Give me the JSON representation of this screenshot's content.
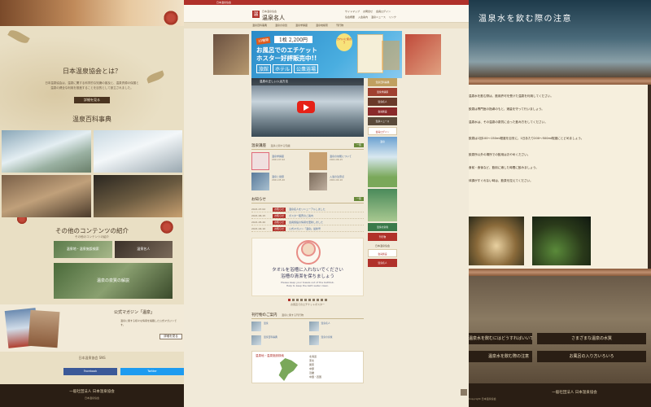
{
  "left": {
    "about_title": "日本温泉協会とは？",
    "about_text": "日本温泉協会は、温泉に関する科学的な知識の普及と、温泉資源の保護と温泉の健全な利用を推進することを目的として設立されました。",
    "about_button": "詳細を見る",
    "dictionary_title": "温泉百科事典",
    "other_title": "その他のコンテンツの紹介",
    "other_sub": "その他のコンテンツの紹介",
    "other_tiles": [
      "温泉地・温泉施設検索",
      "温泉名人",
      "温泉の泉質の解説"
    ],
    "magazine_title": "公式マガジン「温泉」",
    "magazine_text": "温泉に関する様々な情報を掲載した公式マガジンです。",
    "magazine_button": "詳細を見る",
    "sns_caption": "日本温泉協会 SNS",
    "sns_facebook": "Facebook",
    "sns_twitter": "Twitter",
    "footer_org": "一般社団法人 日本温泉協会",
    "footer_small": "日本温泉協会"
  },
  "center": {
    "topbar": "日本温泉協会",
    "logo_mark": "温",
    "logo_sub": "日本温泉協会",
    "logo_main": "温泉名人",
    "util_links": [
      "サイトマップ",
      "お問合せ",
      "会員ログイン"
    ],
    "util_links2": [
      "協会概要",
      "入会案内",
      "温泉ニュース",
      "リンク"
    ],
    "nav": [
      "温泉百科事典",
      "温泉の泉質",
      "温泉学講座",
      "温泉地検索",
      "刊行物"
    ],
    "banner": {
      "tag": "10種類",
      "price": "1枚 2,200円",
      "line1": "お風呂でのエチケット",
      "line2": "ホスター好評販売中!!",
      "places": [
        "旅館",
        "ホテル",
        "公衆浴場"
      ],
      "note": "きれいに使おう"
    },
    "video_title": "温泉の正しい入浴方法",
    "articles_heading": "温泉講座",
    "articles_sub": "温泉に関する知識",
    "articles_more": "一覧",
    "articles": [
      {
        "title": "温泉学講座",
        "date": "2021.07.02"
      },
      {
        "title": "温泉の効能について",
        "date": "2021.06.15"
      },
      {
        "title": "温泉と健康",
        "date": "2021.05.20"
      },
      {
        "title": "入浴の注意点",
        "date": "2021.04.10"
      }
    ],
    "news_heading": "お知らせ",
    "news_more": "一覧",
    "news": [
      {
        "date": "2021.07.02",
        "cat": "お知らせ",
        "title": "温泉名人をリニューアルしました"
      },
      {
        "date": "2021.06.15",
        "cat": "お知らせ",
        "title": "ポスター販売のご案内"
      },
      {
        "date": "2021.05.20",
        "cat": "お知らせ",
        "title": "会員施設の情報を更新しました"
      },
      {
        "date": "2021.04.10",
        "cat": "お知らせ",
        "title": "公式マガジン「温泉」最新号"
      }
    ],
    "poster_line1": "タオルを浴槽に入れないでください",
    "poster_line2": "浴槽の清潔を保ちましょう",
    "poster_en1": "Please keep your towels out of the bathtub.",
    "poster_en2": "Help to keep the bath water clean.",
    "poster_caption": "お風呂でのエチケットポスター",
    "activities_heading": "刊行物のご案内",
    "activities_sub": "温泉に関する刊行物",
    "activities": [
      "温泉",
      "温泉名人",
      "温泉百科事典",
      "温泉の泉質"
    ],
    "map_title": "温泉地・温泉施設検索",
    "map_list": [
      "北海道",
      "東北",
      "関東",
      "中部",
      "近畿",
      "中国・四国",
      "九州・沖縄"
    ],
    "side_items": [
      "温泉百科事典",
      "温泉学講座",
      "温泉名人",
      "会員施設",
      "温泉ニュース",
      "会員ログイン",
      "温泉の泉質",
      "刊行物"
    ],
    "side_tall_label": "温泉",
    "side_label": "日本温泉協会",
    "side_bottom": [
      "会員施設",
      "温泉名人"
    ]
  },
  "right": {
    "hero_title": "温泉水を飲む際の注意",
    "paragraphs": [
      "温泉水を飲む際は、飲用許可を受けた温泉を利用してください。",
      "飲泉は専門医の指導のもと、適量を守って行いましょう。",
      "温泉水は、その温泉の泉質に合った飲み方をしてください。",
      "飲泉は1回100〜150ml程度を目安に、1日あたり200〜500ml程度にとどめましょう。",
      "飲泉所以外の場所での飲用はおやめください。",
      "食前・食後など、飲用に適した時間に飲みましょう。",
      "体調がすぐれない時は、飲泉を控えてください。"
    ],
    "button_left_1": "温泉水を飲むにはどうすればいいですか？",
    "button_left_2": "温泉水を飲む際の注意",
    "button_right_1": "さまざまな温泉の水質",
    "button_right_2": "お風呂の入り方いろいろ",
    "footer_org": "一般社団法人 日本温泉協会",
    "footer_small": "Copyright 日本温泉協会"
  },
  "colors": {
    "brand_red": "#b0312a",
    "footer_dark": "#2a1e14"
  }
}
